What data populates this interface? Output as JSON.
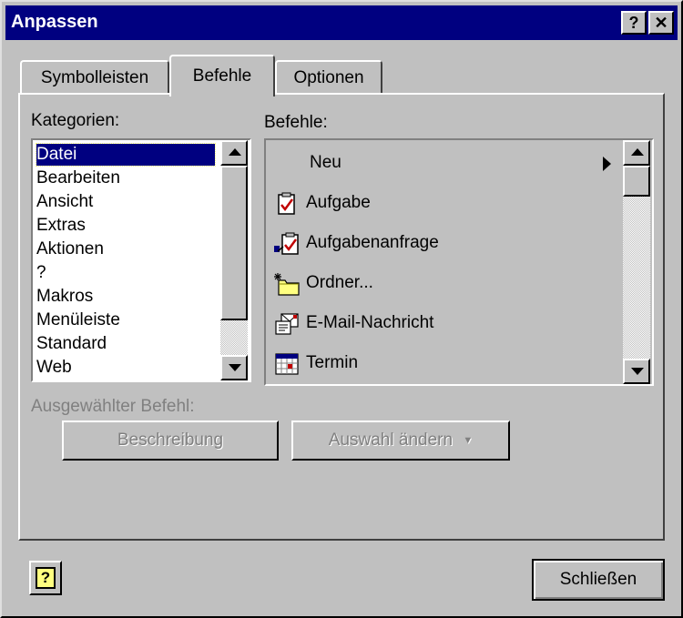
{
  "window": {
    "title": "Anpassen",
    "help_glyph": "?",
    "close_glyph": "✕"
  },
  "tabs": [
    {
      "label": "Symbolleisten",
      "active": false
    },
    {
      "label": "Befehle",
      "active": true
    },
    {
      "label": "Optionen",
      "active": false
    }
  ],
  "categories": {
    "label": "Kategorien:",
    "items": [
      "Datei",
      "Bearbeiten",
      "Ansicht",
      "Extras",
      "Aktionen",
      "?",
      "Makros",
      "Menüleiste",
      "Standard",
      "Web"
    ],
    "selected": "Datei"
  },
  "commands": {
    "label": "Befehle:",
    "items": [
      {
        "label": "Neu",
        "icon": "none",
        "submenu": true
      },
      {
        "label": "Aufgabe",
        "icon": "task-icon"
      },
      {
        "label": "Aufgabenanfrage",
        "icon": "task-request-icon"
      },
      {
        "label": "Ordner...",
        "icon": "new-folder-icon"
      },
      {
        "label": "E-Mail-Nachricht",
        "icon": "mail-message-icon"
      },
      {
        "label": "Termin",
        "icon": "calendar-icon"
      }
    ]
  },
  "selected_command": {
    "label": "Ausgewählter Befehl:",
    "description_button": "Beschreibung",
    "modify_button": "Auswahl ändern",
    "modify_arrow": "▼"
  },
  "footer": {
    "help_glyph": "?",
    "close_button": "Schließen"
  },
  "colors": {
    "face": "#c0c0c0",
    "title_bar": "#000080",
    "selection": "#000080",
    "disabled_text": "#808080"
  }
}
